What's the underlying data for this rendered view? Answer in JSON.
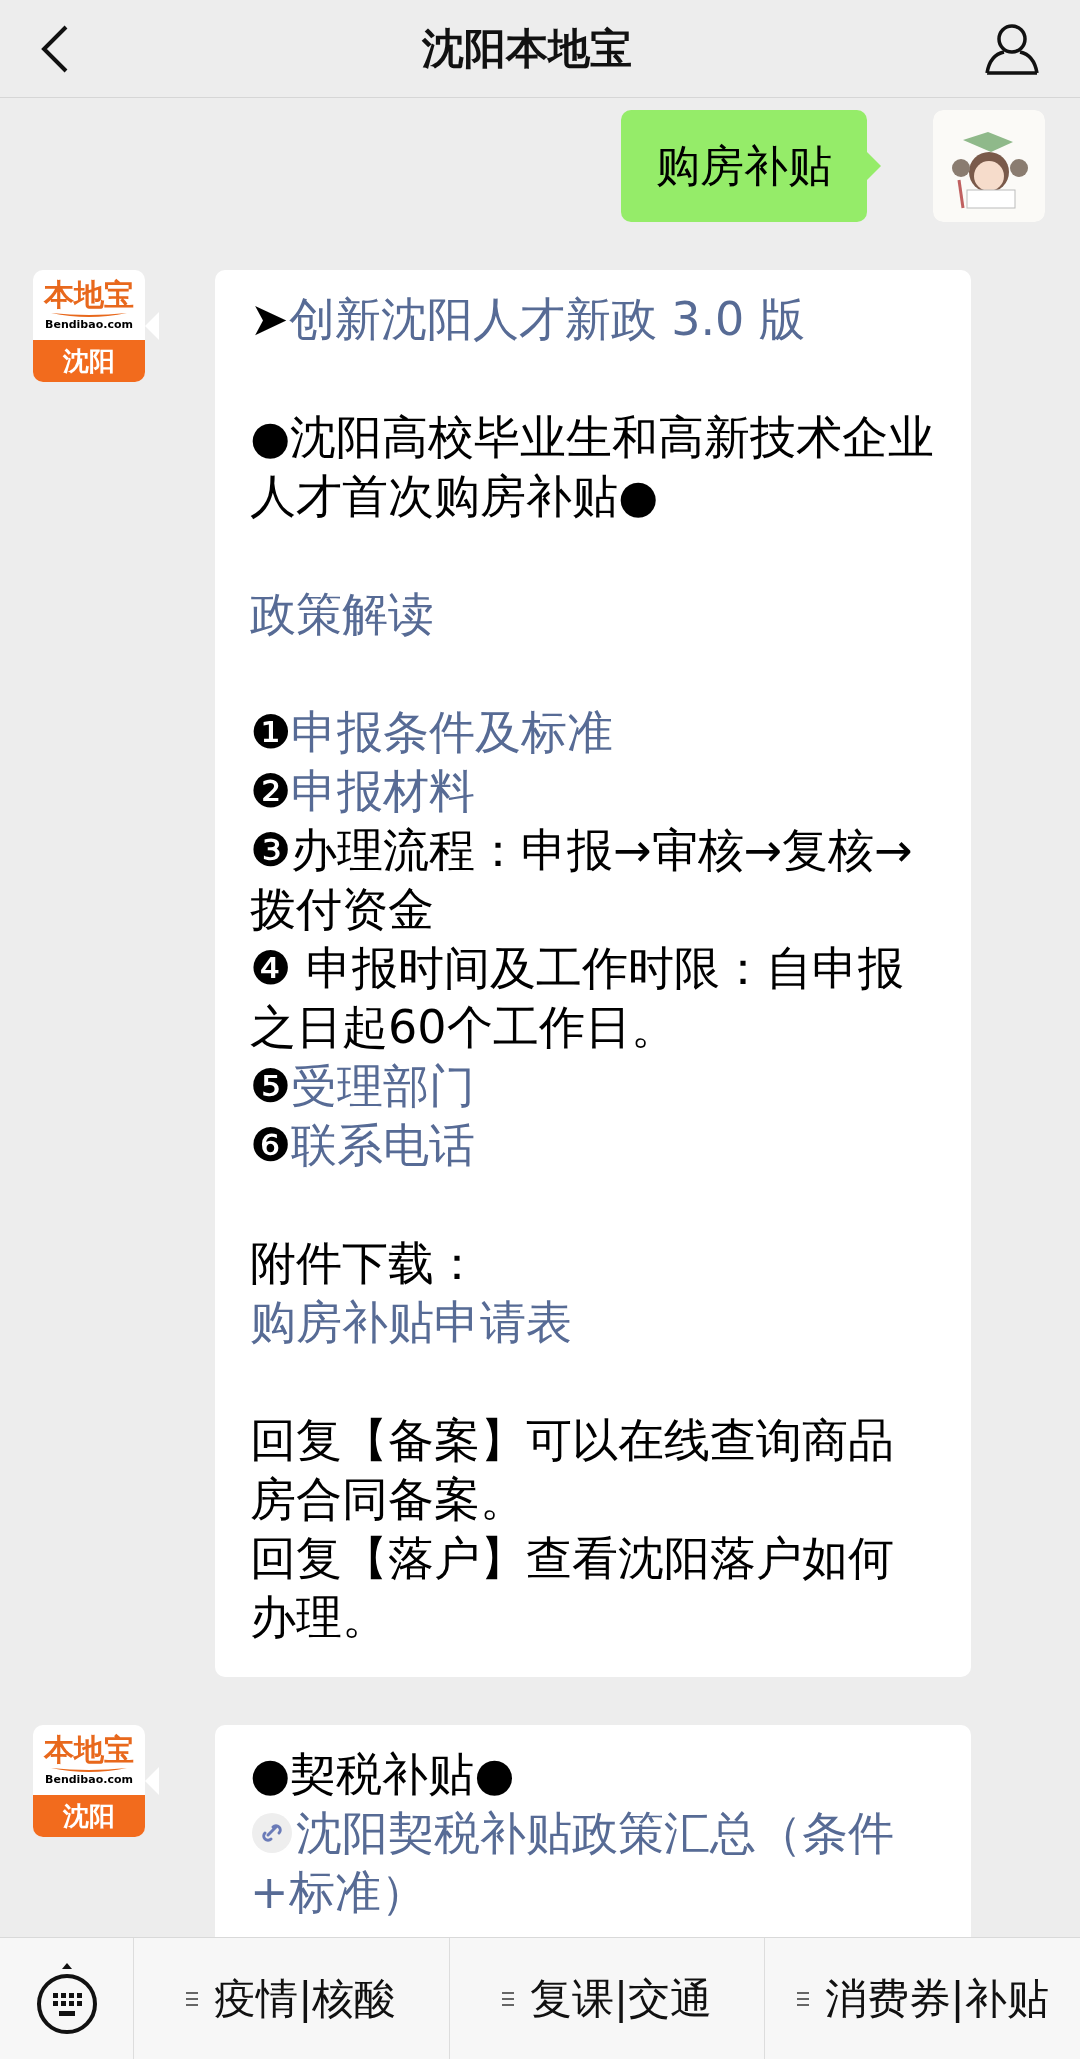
{
  "header": {
    "title": "沈阳本地宝"
  },
  "messages": [
    {
      "kind": "user",
      "text": "购房补贴"
    },
    {
      "kind": "bot",
      "avatar": {
        "name": "本地宝",
        "site": "Bendibao.com",
        "city": "沈阳"
      },
      "paragraphs": [
        [
          {
            "segments": [
              {
                "text": "➤",
                "link": false
              },
              {
                "text": "创新沈阳人才新政 3.0 版",
                "link": true
              }
            ]
          }
        ],
        [
          {
            "segments": [
              {
                "text": "●沈阳高校毕业生和高新技术企业人才首次购房补贴●",
                "link": false
              }
            ]
          }
        ],
        [
          {
            "segments": [
              {
                "text": "政策解读",
                "link": true
              }
            ]
          }
        ],
        [
          {
            "segments": [
              {
                "text": "❶",
                "link": false
              },
              {
                "text": "申报条件及标准",
                "link": true
              }
            ]
          },
          {
            "segments": [
              {
                "text": "❷",
                "link": false
              },
              {
                "text": "申报材料",
                "link": true
              }
            ]
          },
          {
            "segments": [
              {
                "text": "❸办理流程：申报→审核→复核→拨付资金",
                "link": false
              }
            ]
          },
          {
            "segments": [
              {
                "text": "❹ 申报时间及工作时限：自申报之日起60个工作日。",
                "link": false
              }
            ]
          },
          {
            "segments": [
              {
                "text": "❺",
                "link": false
              },
              {
                "text": "受理部门",
                "link": true
              }
            ]
          },
          {
            "segments": [
              {
                "text": "❻",
                "link": false
              },
              {
                "text": "联系电话",
                "link": true
              }
            ]
          }
        ],
        [
          {
            "segments": [
              {
                "text": "附件下载：",
                "link": false
              }
            ]
          },
          {
            "segments": [
              {
                "text": "购房补贴申请表",
                "link": true
              }
            ]
          }
        ],
        [
          {
            "segments": [
              {
                "text": "回复【备案】可以在线查询商品房合同备案。",
                "link": false
              }
            ]
          },
          {
            "segments": [
              {
                "text": "回复【落户】查看沈阳落户如何办理。",
                "link": false
              }
            ]
          }
        ]
      ]
    },
    {
      "kind": "bot",
      "avatar": {
        "name": "本地宝",
        "site": "Bendibao.com",
        "city": "沈阳"
      },
      "paragraphs": [
        [
          {
            "segments": [
              {
                "text": "●契税补贴●",
                "link": false
              }
            ]
          },
          {
            "link_icon": true,
            "segments": [
              {
                "text": "沈阳契税补贴政策汇总（条件+标准）",
                "link": true
              }
            ]
          }
        ]
      ]
    }
  ],
  "menu": [
    "疫情|核酸",
    "复课|交通",
    "消费券|补贴"
  ]
}
